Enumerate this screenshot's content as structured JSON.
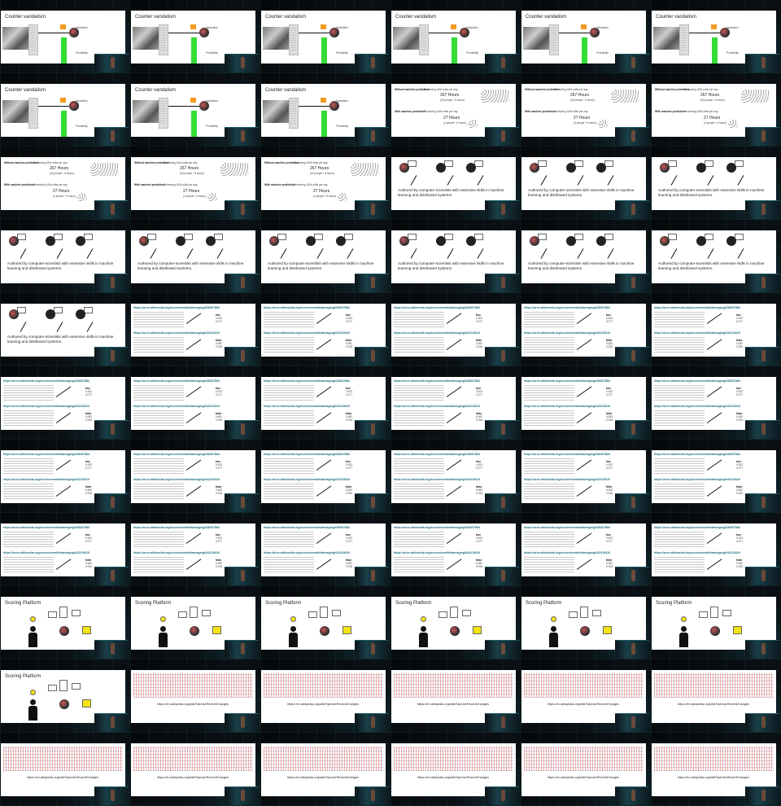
{
  "slide_texts": {
    "counter_vandalism_title": "Counter vandalism",
    "counter_label_top": "Vandalism",
    "counter_label_bottom": "Probability",
    "without_ml": "Without machine prediction:",
    "reviewing": "Reviewing 160k edits per day",
    "hours_267": "267 Hours",
    "people_267": "(33 people * 8 hours)",
    "with_ml": "With machine prediction:",
    "hours_27": "27 Hours",
    "people_27": "(4 people * 8 hours)",
    "authored": "Authored by computer-scientists with extensive skills in machine learning and distributed systems.",
    "url_1": "https://ores.wikimedia.org/scores/enwiki/damaging/638307884",
    "url_2": "https://ores.wikimedia.org/scores/enwiki/damaging/642215410",
    "score_true": "true",
    "score_a": "0.923",
    "score_b": "0.077",
    "score_false": "false",
    "score_c": "0.082",
    "score_d": "0.918",
    "scoring_platform_title": "Scoring Platform",
    "recent_changes": "https://en.wikipedia.org/wiki/Special:RecentChanges"
  },
  "cells": [
    "counter",
    "counter",
    "counter",
    "counter",
    "counter",
    "counter",
    "counter",
    "counter",
    "counter",
    "hours",
    "hours",
    "hours",
    "hours",
    "hours",
    "hours",
    "authored",
    "authored",
    "authored",
    "authored",
    "authored",
    "authored",
    "authored",
    "authored",
    "authored",
    "authored",
    "ores",
    "ores",
    "ores",
    "ores",
    "ores",
    "ores",
    "ores",
    "ores",
    "ores",
    "ores",
    "ores",
    "ores",
    "ores",
    "ores",
    "ores",
    "ores",
    "ores",
    "ores",
    "ores",
    "ores",
    "ores",
    "ores",
    "ores",
    "scoring",
    "scoring",
    "scoring",
    "scoring",
    "scoring",
    "scoring",
    "scoring",
    "recent",
    "recent",
    "recent",
    "recent",
    "recent",
    "recent",
    "recent",
    "recent",
    "recent",
    "recent",
    "recent"
  ]
}
